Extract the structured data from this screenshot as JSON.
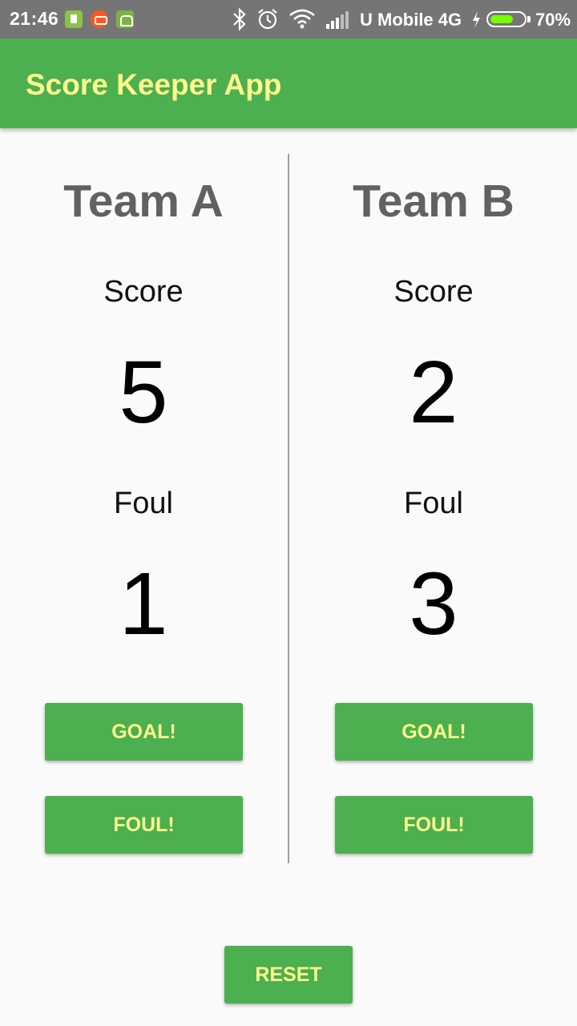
{
  "status_bar": {
    "time": "21:46",
    "carrier": "U Mobile 4G",
    "battery": "70%",
    "battery_level": 0.7,
    "icons": [
      "sim-app-icon",
      "camera-app-icon",
      "android-app-icon",
      "bluetooth-icon",
      "alarm-icon",
      "wifi-icon",
      "signal-icon",
      "charging-icon",
      "battery-icon"
    ]
  },
  "app_bar": {
    "title": "Score Keeper App"
  },
  "team_a": {
    "name": "Team A",
    "score_label": "Score",
    "score": "5",
    "foul_label": "Foul",
    "fouls": "1",
    "goal_button": "GOAL!",
    "foul_button": "FOUL!"
  },
  "team_b": {
    "name": "Team B",
    "score_label": "Score",
    "score": "2",
    "foul_label": "Foul",
    "fouls": "3",
    "goal_button": "GOAL!",
    "foul_button": "FOUL!"
  },
  "reset_button": "RESET",
  "colors": {
    "primary": "#4caf50",
    "accent_text": "#fffa8c",
    "status_bar": "#757575",
    "background": "#fafafa"
  }
}
